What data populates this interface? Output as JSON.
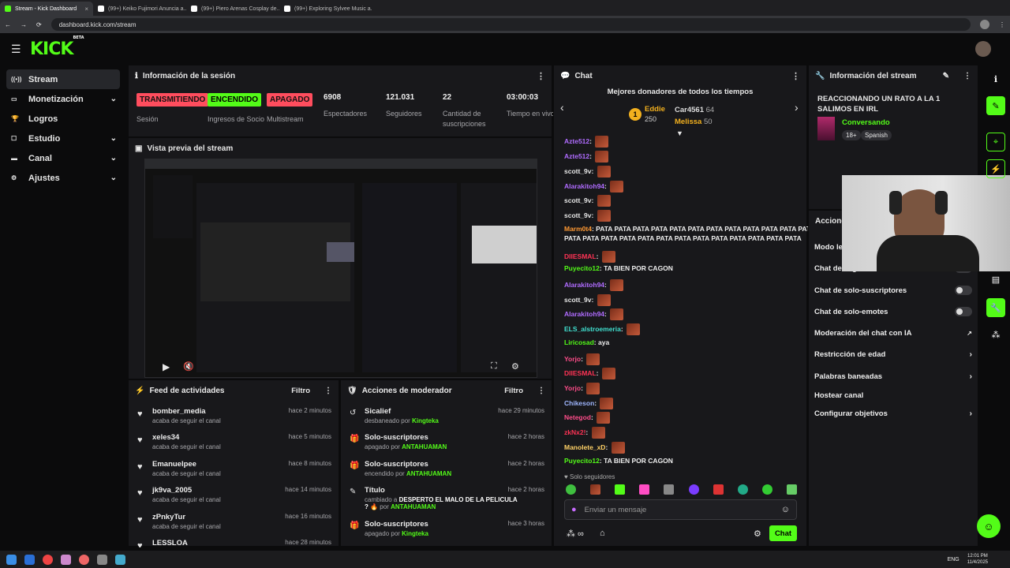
{
  "browser": {
    "tabs": [
      {
        "title": "Stream - Kick Dashboard",
        "color": "#53fc18"
      },
      {
        "title": "(99+) Keiko Fujimori Anuncia a...",
        "color": "#ffffff"
      },
      {
        "title": "(99+) Piero Arenas Cosplay de...",
        "color": "#ffffff"
      },
      {
        "title": "(99+) Exploring Sylvee Music a...",
        "color": "#ffffff"
      }
    ],
    "url": "dashboard.kick.com/stream"
  },
  "brand": {
    "logo": "KICK",
    "beta": "BETA",
    "accent": "#53fc18"
  },
  "sidebar": {
    "items": [
      {
        "label": "Stream",
        "icon": "stream-icon"
      },
      {
        "label": "Monetización",
        "icon": "money-icon"
      },
      {
        "label": "Logros",
        "icon": "trophy-icon"
      },
      {
        "label": "Estudio",
        "icon": "studio-icon"
      },
      {
        "label": "Canal",
        "icon": "channel-icon"
      },
      {
        "label": "Ajustes",
        "icon": "gear-icon"
      }
    ]
  },
  "session": {
    "title": "Información de la sesión",
    "stats": [
      {
        "value": "TRANSMITIENDO",
        "label": "Sesión",
        "color": "#ff4d5e"
      },
      {
        "value": "ENCENDIDO",
        "label": "Ingresos de Socio",
        "color": "#53fc18"
      },
      {
        "value": "APAGADO",
        "label": "Multistream",
        "color": "#ff4d5e"
      },
      {
        "value": "6908",
        "label": "Espectadores"
      },
      {
        "value": "121.031",
        "label": "Seguidores"
      },
      {
        "value": "22",
        "label": "Cantidad de suscripciones"
      },
      {
        "value": "03:00:03",
        "label": "Tiempo en vivo"
      }
    ]
  },
  "preview": {
    "title": "Vista previa del stream"
  },
  "feed": {
    "title": "Feed de actividades",
    "filter": "Filtro",
    "items": [
      {
        "name": "bomber_media",
        "sub": "acaba de seguir el canal",
        "time": "hace 2 minutos"
      },
      {
        "name": "xeles34",
        "sub": "acaba de seguir el canal",
        "time": "hace 5 minutos"
      },
      {
        "name": "Emanuelpee",
        "sub": "acaba de seguir el canal",
        "time": "hace 8 minutos"
      },
      {
        "name": "jk9va_2005",
        "sub": "acaba de seguir el canal",
        "time": "hace 14 minutos"
      },
      {
        "name": "zPnkyTur",
        "sub": "acaba de seguir el canal",
        "time": "hace 16 minutos"
      },
      {
        "name": "LESSLOA",
        "sub": "",
        "time": "hace 28 minutos"
      }
    ]
  },
  "mod": {
    "title": "Acciones de moderador",
    "filter": "Filtro",
    "items": [
      {
        "name": "Sicalief",
        "pre": "desbaneado por ",
        "bold": "",
        "by": "Kingteka",
        "time": "hace 29 minutos"
      },
      {
        "name": "Solo-suscriptores",
        "pre": "apagado por ",
        "bold": "",
        "by": "ANTAHUAMAN",
        "time": "hace 2 horas"
      },
      {
        "name": "Solo-suscriptores",
        "pre": "encendido por ",
        "bold": "",
        "by": "ANTAHUAMAN",
        "time": "hace 2 horas"
      },
      {
        "name": "Título",
        "pre": "cambiado a ",
        "bold": "DESPERTO EL MALO DE LA PELICULA ?",
        "by": "ANTAHUAMAN",
        "time": "hace 2 horas"
      },
      {
        "name": "Solo-suscriptores",
        "pre": "apagado por ",
        "bold": "",
        "by": "Kingteka",
        "time": "hace 3 horas"
      }
    ]
  },
  "chat": {
    "title": "Chat",
    "donors_title": "Mejores donadores de todos los tiempos",
    "donors": [
      {
        "rank": "1",
        "name": "Eddie",
        "amount": "250"
      },
      {
        "name": "Car4561",
        "amount": "64"
      },
      {
        "name": "Melissa",
        "amount": "50"
      }
    ],
    "messages": [
      {
        "user": "Azte512",
        "text": "",
        "color": "#b06cff"
      },
      {
        "user": "Azte512",
        "text": "",
        "color": "#b06cff"
      },
      {
        "user": "scott_9v",
        "text": "",
        "color": "#e8e8e8"
      },
      {
        "user": "Alarakitoh94",
        "text": "",
        "color": "#b06cff"
      },
      {
        "user": "scott_9v",
        "text": "",
        "color": "#e8e8e8"
      },
      {
        "user": "scott_9v",
        "text": "",
        "color": "#e8e8e8"
      },
      {
        "user": "Marm0t4",
        "text": "PATA PATA PATA PATA PATA PATA PATA PATA PATA PATA PATA PATA",
        "color": "#ff9933"
      },
      {
        "user": "",
        "text": "PATA PATA PATA PATA PATA PATA PATA PATA PATA PATA PATA PATA PATA",
        "color": "#eee"
      },
      {
        "user": "DIIESMAL",
        "text": "",
        "color": "#ff3355"
      },
      {
        "user": "Puyecito12",
        "text": "TA BIEN POR CAGON",
        "color": "#53fc18"
      },
      {
        "user": "Alarakitoh94",
        "text": "",
        "color": "#b06cff"
      },
      {
        "user": "scott_9v",
        "text": "",
        "color": "#e8e8e8"
      },
      {
        "user": "Alarakitoh94",
        "text": "",
        "color": "#b06cff"
      },
      {
        "user": "ELS_alstroemeria",
        "text": "",
        "color": "#40e0d0"
      },
      {
        "user": "Liricosad",
        "text": "aya",
        "color": "#53fc18"
      },
      {
        "user": "Yorjo",
        "text": "",
        "color": "#ff4d8a"
      },
      {
        "user": "DIIESMAL",
        "text": "",
        "color": "#ff3355"
      },
      {
        "user": "Yorjo",
        "text": "",
        "color": "#ff4d8a"
      },
      {
        "user": "Chikeson",
        "text": "",
        "color": "#9fb6ff"
      },
      {
        "user": "Netegod",
        "text": "",
        "color": "#ff4d8a"
      },
      {
        "user": "zkNx2!",
        "text": "",
        "color": "#ff3355"
      },
      {
        "user": "Manolete_xD",
        "text": "",
        "color": "#ffd166"
      },
      {
        "user": "Puyecito12",
        "text": "TA BIEN POR CAGON",
        "color": "#53fc18"
      }
    ],
    "followers_only": "Solo seguidores",
    "input_placeholder": "Enviar un mensaje",
    "send_label": "Chat"
  },
  "stream_info": {
    "title": "Información del stream",
    "stream_title": "REACCIONANDO UN RATO A LA 1 SALIMOS EN IRL",
    "category": "Conversando",
    "tags": [
      "18+",
      "Spanish"
    ]
  },
  "chat_settings": {
    "title": "Acciones rápidas",
    "rows": [
      {
        "label": "Modo lento",
        "type": "toggle"
      },
      {
        "label": "Chat de seguidores",
        "type": "toggle"
      },
      {
        "label": "Chat de solo-suscriptores",
        "type": "toggle"
      },
      {
        "label": "Chat de solo-emotes",
        "type": "toggle"
      },
      {
        "label": "Moderación del chat con IA",
        "type": "link"
      },
      {
        "label": "Restricción de edad",
        "type": "chevron"
      },
      {
        "label": "Palabras baneadas",
        "type": "chevron"
      },
      {
        "label": "Hostear canal",
        "type": "none"
      },
      {
        "label": "Configurar objetivos",
        "type": "chevron"
      }
    ]
  },
  "taskbar": {
    "lang": "ENG",
    "time": "12:01 PM",
    "date": "11/4/2025"
  }
}
